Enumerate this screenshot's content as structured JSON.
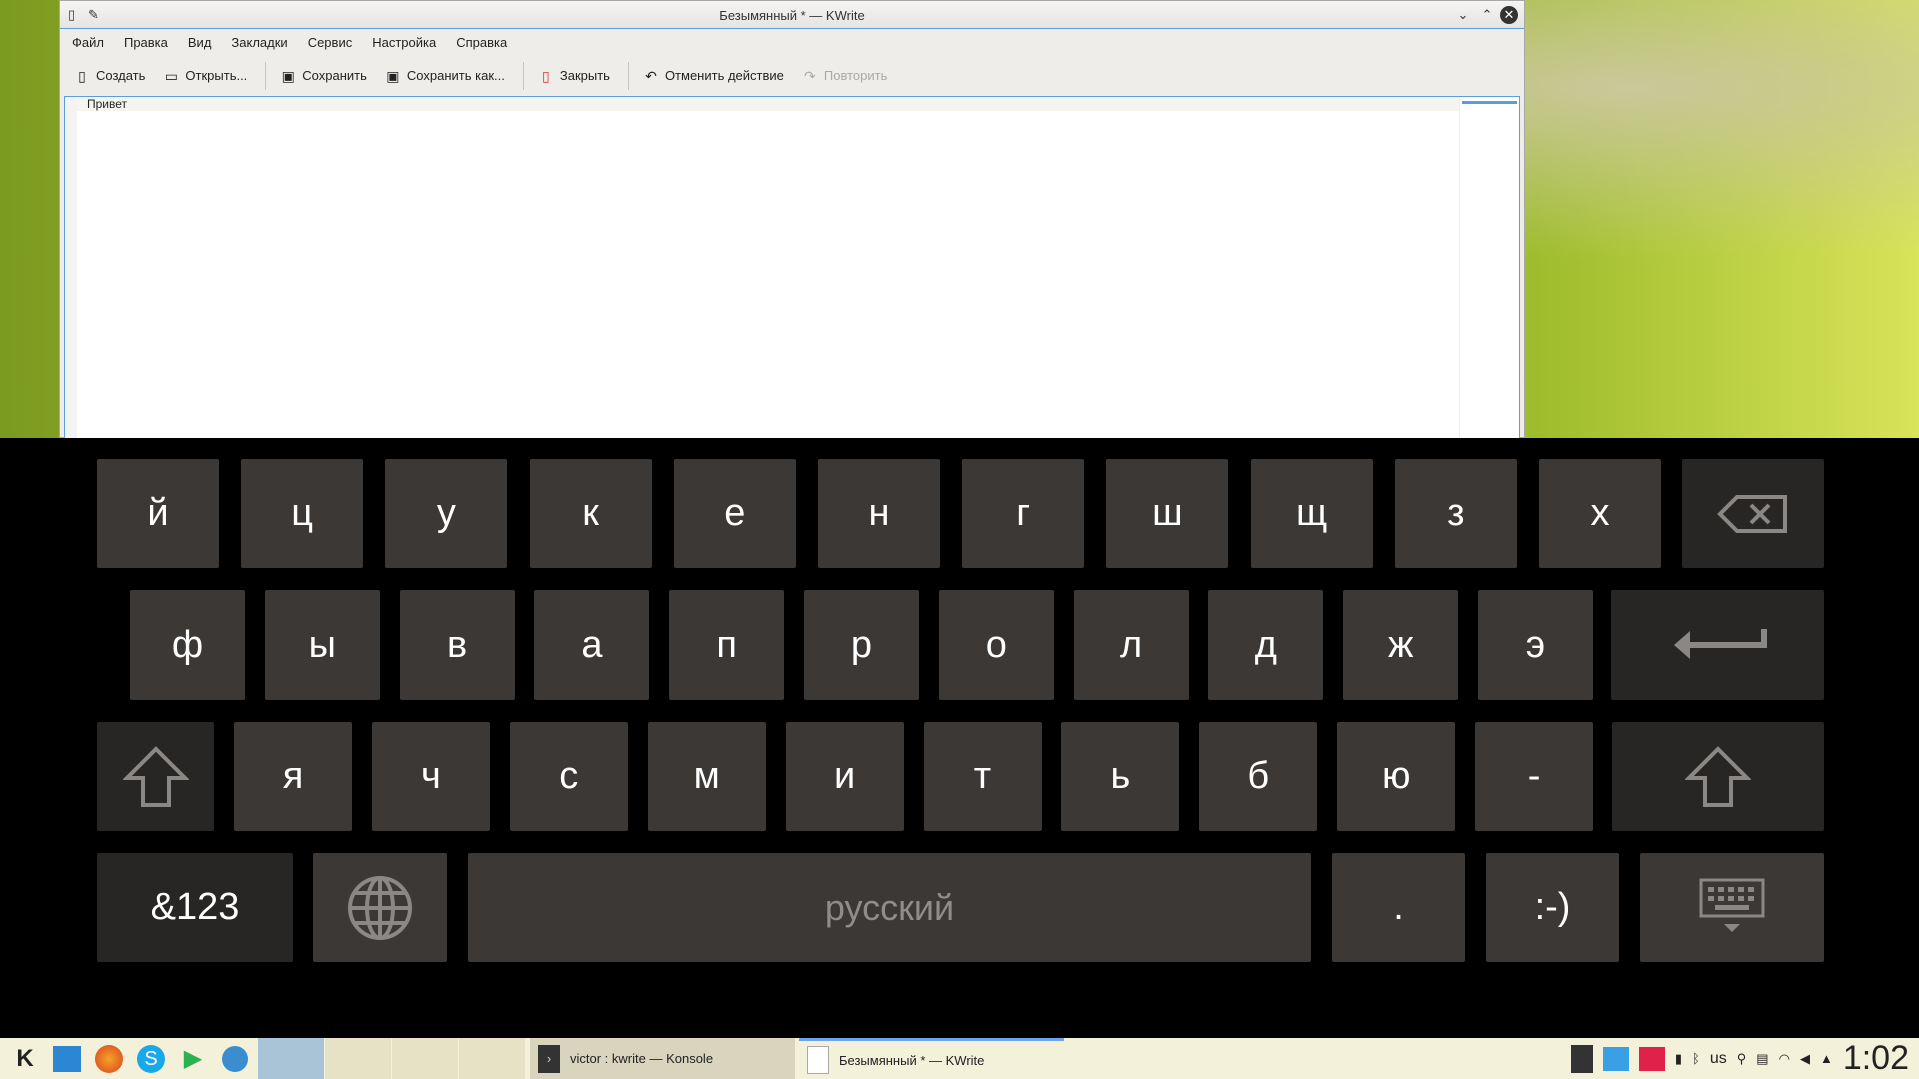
{
  "window": {
    "title": "Безымянный * — KWrite"
  },
  "menu": [
    "Файл",
    "Правка",
    "Вид",
    "Закладки",
    "Сервис",
    "Настройка",
    "Справка"
  ],
  "toolbar": {
    "new": "Создать",
    "open": "Открыть...",
    "save": "Сохранить",
    "save_as": "Сохранить как...",
    "close": "Закрыть",
    "undo": "Отменить действие",
    "redo": "Повторить"
  },
  "editor": {
    "text": "Привет"
  },
  "keyboard": {
    "row1": [
      "й",
      "ц",
      "у",
      "к",
      "е",
      "н",
      "г",
      "ш",
      "щ",
      "з",
      "х"
    ],
    "row2": [
      "ф",
      "ы",
      "в",
      "а",
      "п",
      "р",
      "о",
      "л",
      "д",
      "ж",
      "э"
    ],
    "row3": [
      "я",
      "ч",
      "с",
      "м",
      "и",
      "т",
      "ь",
      "б",
      "ю",
      "-"
    ],
    "symbols": "&123",
    "space": "русский",
    "period": ".",
    "smiley": ":-)"
  },
  "taskbar": {
    "tasks": [
      {
        "label": "victor : kwrite — Konsole"
      },
      {
        "label": "Безымянный * — KWrite"
      }
    ],
    "layout": "us",
    "clock": "1:02"
  }
}
